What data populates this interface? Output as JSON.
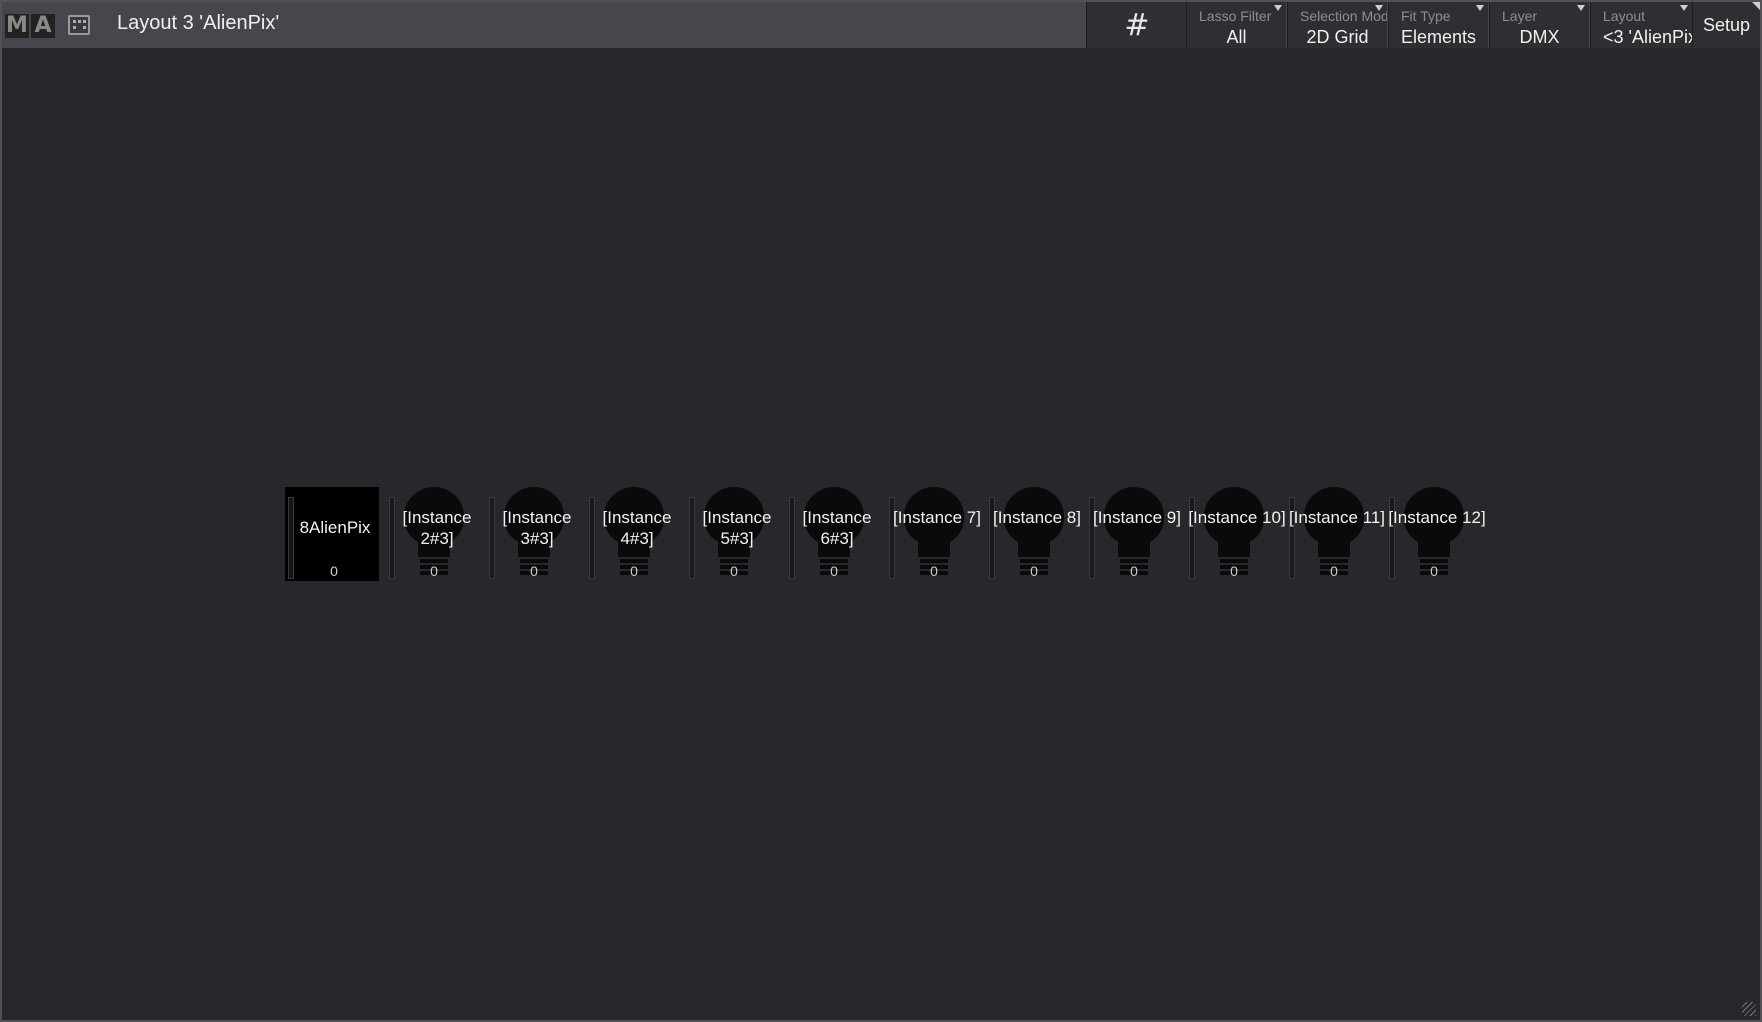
{
  "app": {
    "logo_letters": [
      "M",
      "A"
    ],
    "title": "Layout 3 'AlienPix'"
  },
  "toolbar": {
    "grid_icon": "#",
    "controls": [
      {
        "label": "Lasso Filter",
        "value": "All"
      },
      {
        "label": "Selection Mod",
        "value": "2D Grid"
      },
      {
        "label": "Fit Type",
        "value": "Elements"
      },
      {
        "label": "Layer",
        "value": "DMX"
      },
      {
        "label": "Layout",
        "value": "<3 'AlienPix"
      }
    ],
    "setup_label": "Setup"
  },
  "fixtures": [
    {
      "name": "8AlienPix",
      "level": "0"
    },
    {
      "name": "[Instance 2#3]",
      "level": "0"
    },
    {
      "name": "[Instance 3#3]",
      "level": "0"
    },
    {
      "name": "[Instance 4#3]",
      "level": "0"
    },
    {
      "name": "[Instance 5#3]",
      "level": "0"
    },
    {
      "name": "[Instance 6#3]",
      "level": "0"
    },
    {
      "name": "[Instance 7]",
      "level": "0"
    },
    {
      "name": "[Instance 8]",
      "level": "0"
    },
    {
      "name": "[Instance 9]",
      "level": "0"
    },
    {
      "name": "[Instance 10]",
      "level": "0"
    },
    {
      "name": "[Instance 11]",
      "level": "0"
    },
    {
      "name": "[Instance 12]",
      "level": "0"
    }
  ],
  "colors": {
    "background": "#27282b",
    "titlebar": "#45474c",
    "fixture_fill": "#0a0a0a"
  }
}
